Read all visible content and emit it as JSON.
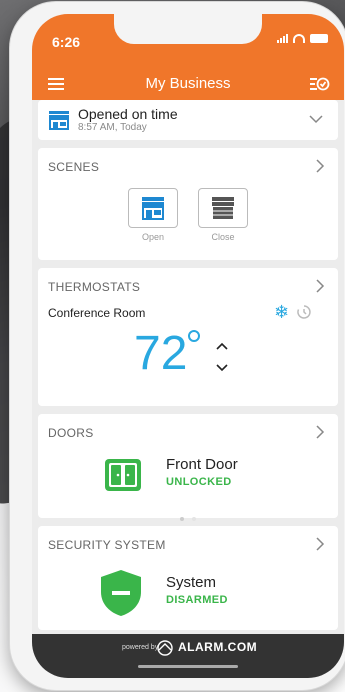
{
  "status_bar": {
    "time": "6:26"
  },
  "nav": {
    "title": "My Business"
  },
  "status_card": {
    "title": "Opened on time",
    "subtitle": "8:57 AM, Today"
  },
  "scenes": {
    "title": "SCENES",
    "items": [
      {
        "label": "Open",
        "icon": "store-open-icon"
      },
      {
        "label": "Close",
        "icon": "store-closed-icon"
      }
    ]
  },
  "thermostats": {
    "title": "THERMOSTATS",
    "room": "Conference Room",
    "temperature": "72",
    "mode_icon": "snowflake-icon",
    "temp_color": "#29a8e0"
  },
  "doors": {
    "title": "DOORS",
    "name": "Front Door",
    "status": "UNLOCKED"
  },
  "security": {
    "title": "SECURITY SYSTEM",
    "name": "System",
    "status": "DISARMED"
  },
  "footer": {
    "powered": "powered by",
    "brand": "ALARM.COM"
  },
  "colors": {
    "accent": "#f0762a",
    "status_green": "#3ab54a",
    "link_blue": "#1e88d1"
  }
}
